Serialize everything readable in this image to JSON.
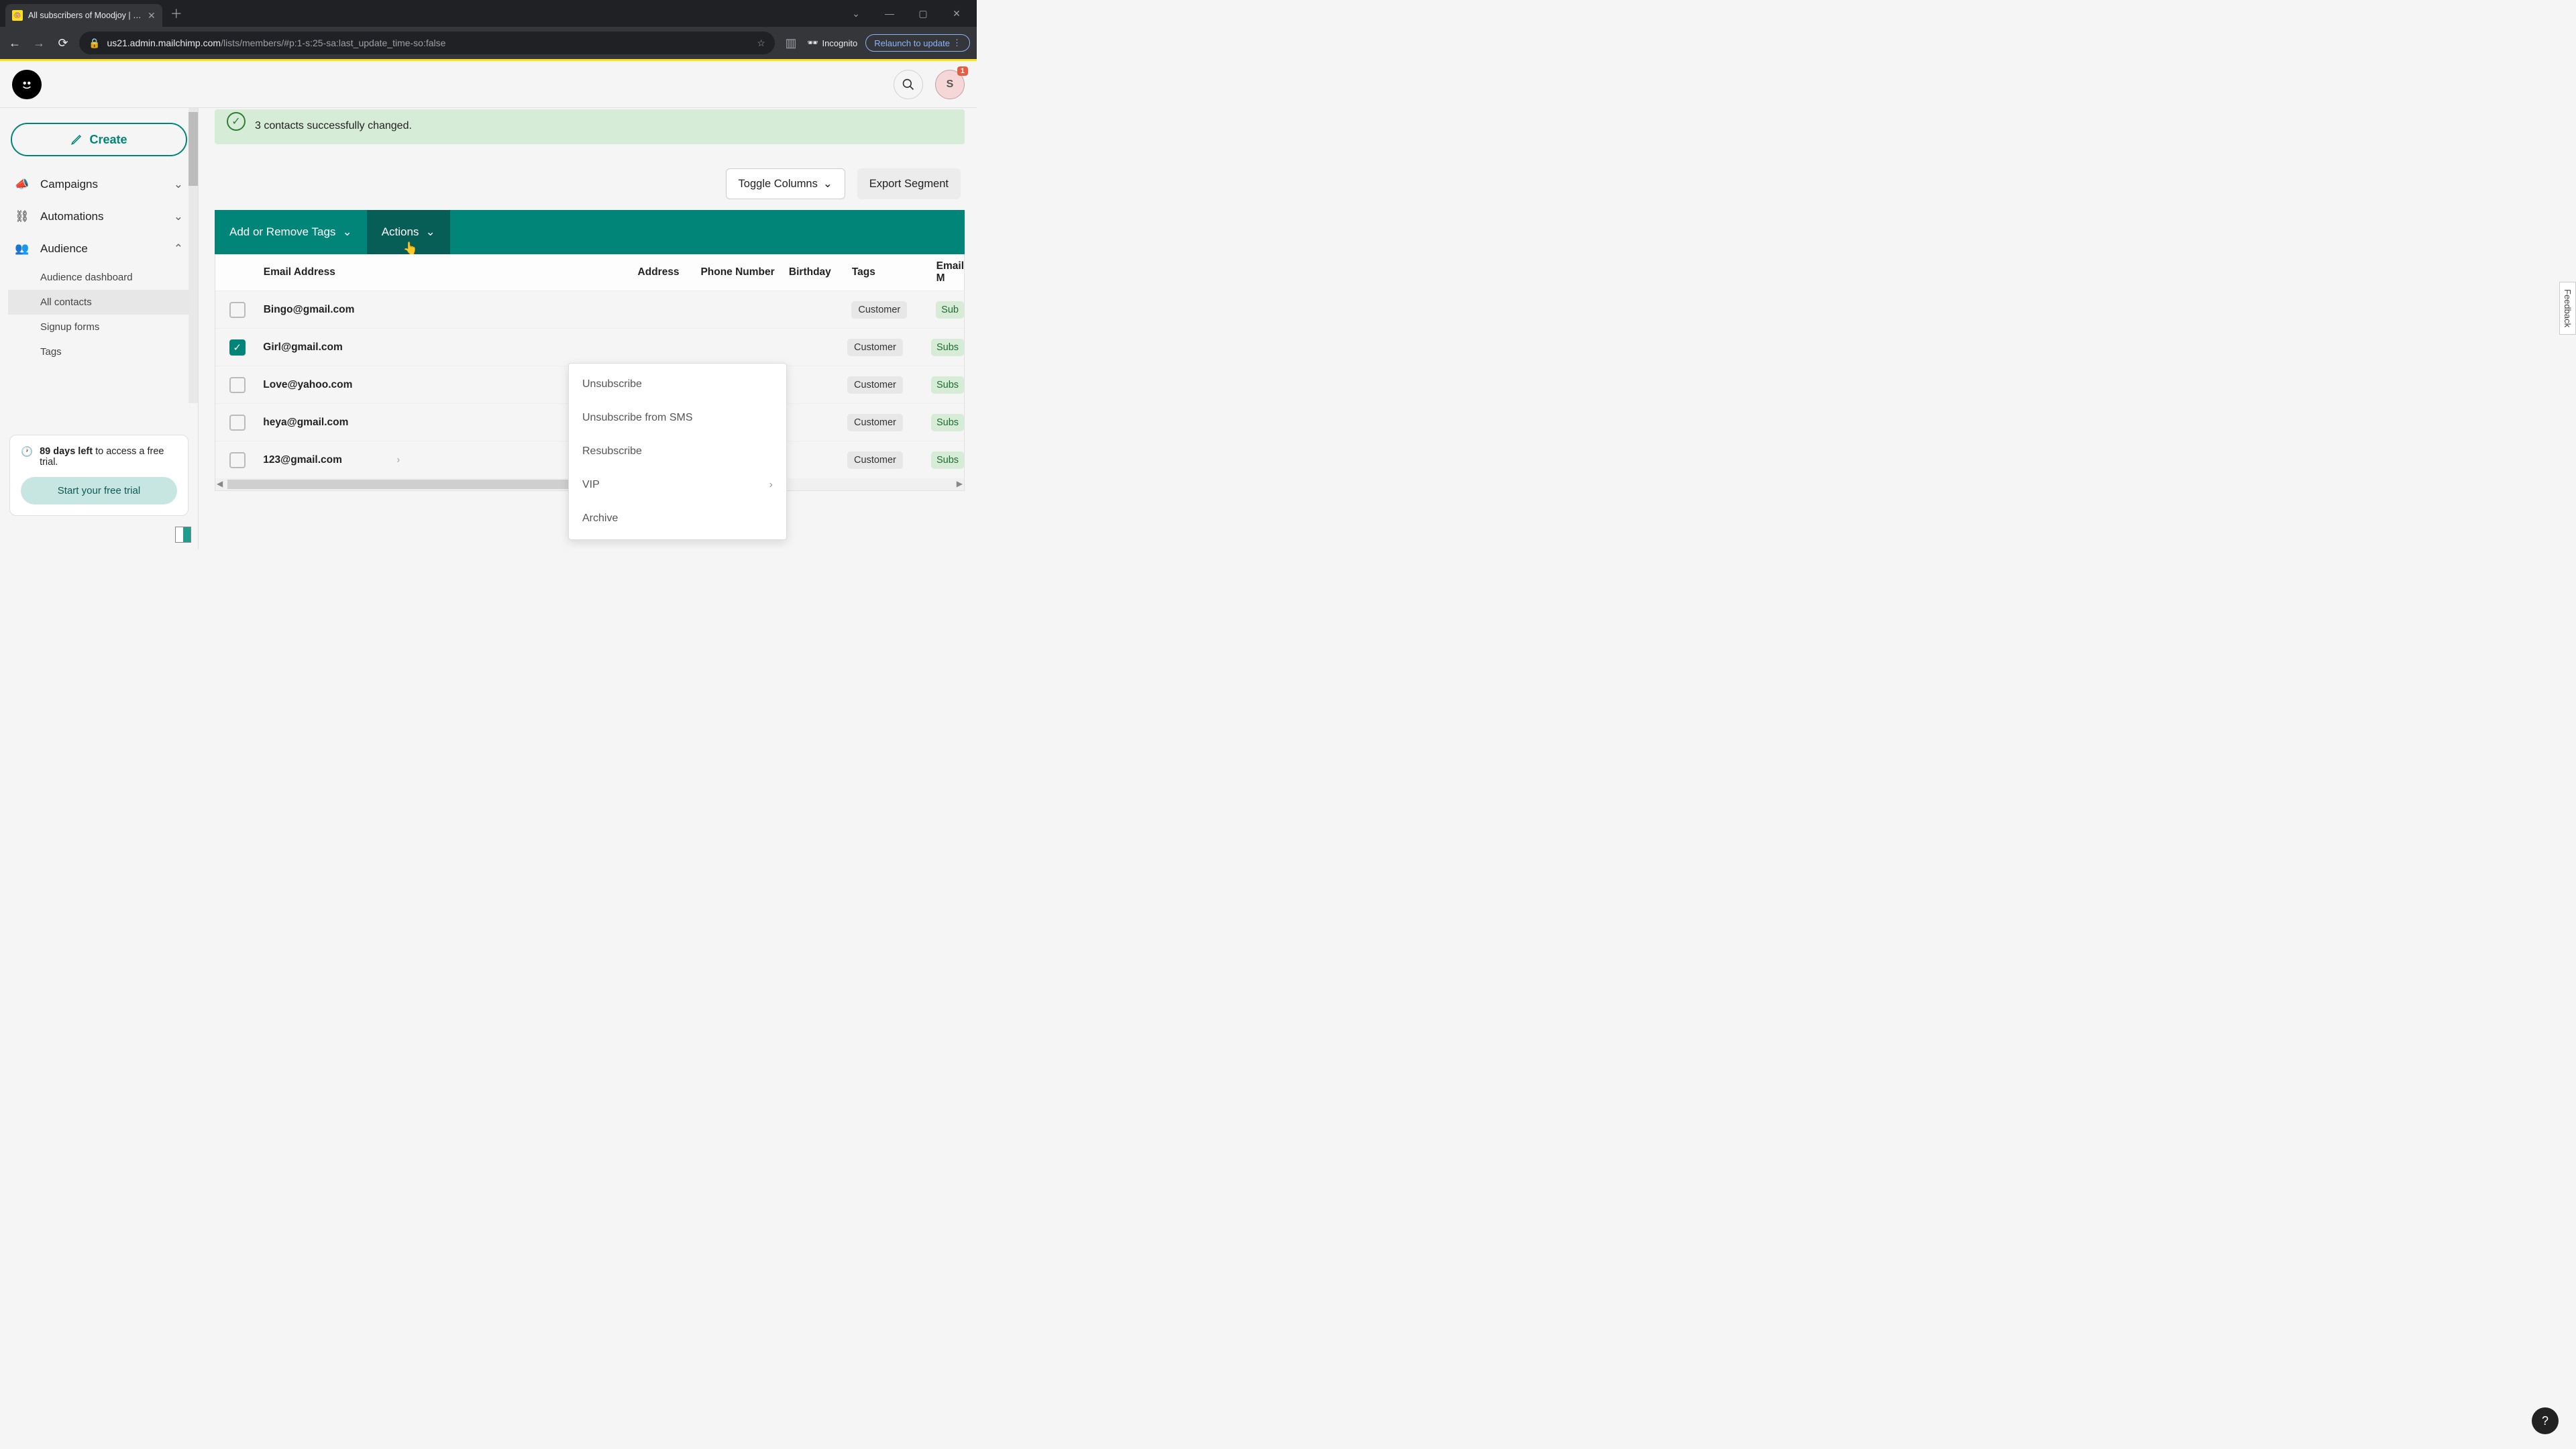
{
  "browser": {
    "tab_title": "All subscribers of Moodjoy | Ma",
    "url_host": "us21.admin.mailchimp.com",
    "url_path": "/lists/members/#p:1-s:25-sa:last_update_time-so:false",
    "incognito_label": "Incognito",
    "relaunch_label": "Relaunch to update"
  },
  "header": {
    "avatar_initial": "S",
    "avatar_badge": "1"
  },
  "sidebar": {
    "create_label": "Create",
    "items": [
      {
        "label": "Campaigns",
        "expanded": false
      },
      {
        "label": "Automations",
        "expanded": false
      },
      {
        "label": "Audience",
        "expanded": true
      }
    ],
    "audience_subitems": [
      {
        "label": "Audience dashboard",
        "active": false
      },
      {
        "label": "All contacts",
        "active": true
      },
      {
        "label": "Signup forms",
        "active": false
      },
      {
        "label": "Tags",
        "active": false
      }
    ],
    "trial_days": "89 days left",
    "trial_rest": " to access a free trial.",
    "trial_button": "Start your free trial"
  },
  "banner": {
    "text": "3 contacts successfully changed."
  },
  "controls": {
    "toggle_columns": "Toggle Columns",
    "export_segment": "Export Segment"
  },
  "action_bar": {
    "tags_label": "Add or Remove Tags",
    "actions_label": "Actions"
  },
  "actions_menu": [
    {
      "label": "Unsubscribe",
      "has_submenu": false
    },
    {
      "label": "Unsubscribe from SMS",
      "has_submenu": false
    },
    {
      "label": "Resubscribe",
      "has_submenu": false
    },
    {
      "label": "VIP",
      "has_submenu": true
    },
    {
      "label": "Archive",
      "has_submenu": false
    }
  ],
  "table": {
    "headers": {
      "email": "Email Address",
      "address": "Address",
      "phone": "Phone Number",
      "birthday": "Birthday",
      "tags": "Tags",
      "email_marketing": "Email M"
    },
    "rows": [
      {
        "checked": false,
        "email": "Bingo@gmail.com",
        "tag": "Customer",
        "status": "Sub"
      },
      {
        "checked": true,
        "email": "Girl@gmail.com",
        "tag": "Customer",
        "status": "Subs"
      },
      {
        "checked": false,
        "email": "Love@yahoo.com",
        "tag": "Customer",
        "status": "Subs"
      },
      {
        "checked": false,
        "email": "heya@gmail.com",
        "tag": "Customer",
        "status": "Subs"
      },
      {
        "checked": false,
        "email": "123@gmail.com",
        "tag": "Customer",
        "status": "Subs"
      }
    ]
  },
  "feedback_label": "Feedback",
  "help_label": "?"
}
